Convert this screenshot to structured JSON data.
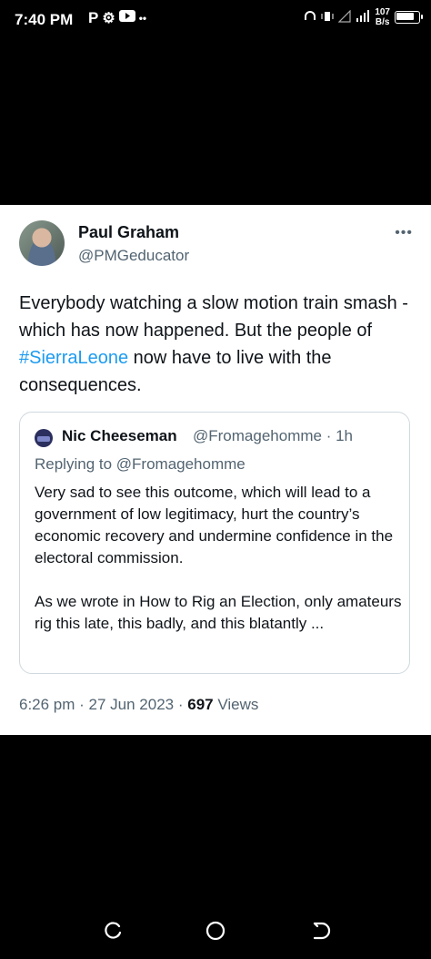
{
  "status_bar": {
    "time": "7:40 PM",
    "left_icons": [
      "p-icon",
      "gear-icon",
      "youtube-icon",
      "dots-icon"
    ],
    "net_speed_value": "107",
    "net_speed_unit": "B/s",
    "battery_level": 0.85
  },
  "tweet": {
    "author_name": "Paul Graham",
    "author_handle": "@PMGeducator",
    "text_before": "Everybody watching a slow motion train smash - which has now happened. But the people of ",
    "hashtag": "#SierraLeone",
    "text_after": " now have to live with the consequences.",
    "quoted": {
      "author_name": "Nic Cheeseman",
      "meta": "@Fromagehomme · 1h",
      "replying_to": "Replying to @Fromagehomme",
      "paragraph1": "Very sad to see this outcome, which will lead to a government of low legitimacy, hurt the country’s economic recovery and undermine confidence in the electoral commission.",
      "paragraph2": "As we wrote in How to Rig an Election, only amateurs rig this late, this badly, and this blatantly ..."
    },
    "timestamp": "6:26 pm · 27 Jun 2023 · ",
    "views_count": "697",
    "views_label": " Views"
  },
  "colors": {
    "link": "#1d9bf0",
    "secondary_text": "#536471",
    "primary_text": "#0f1419"
  }
}
